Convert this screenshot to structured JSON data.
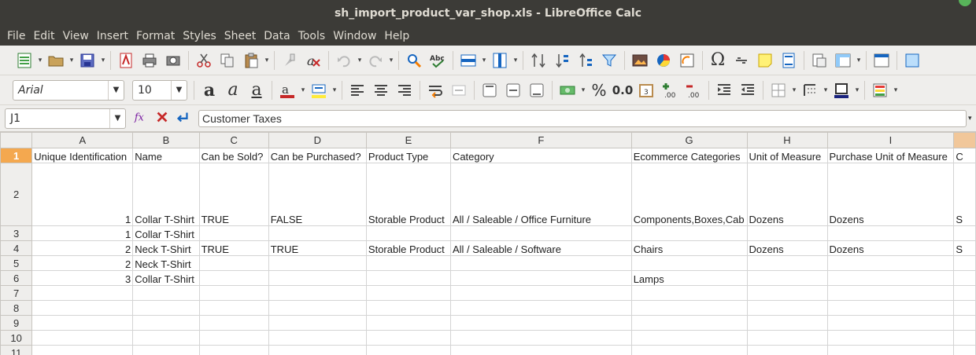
{
  "window": {
    "title": "sh_import_product_var_shop.xls - LibreOffice Calc"
  },
  "menu": [
    "File",
    "Edit",
    "View",
    "Insert",
    "Format",
    "Styles",
    "Sheet",
    "Data",
    "Tools",
    "Window",
    "Help"
  ],
  "toolbar": {
    "font_name": "Arial",
    "font_size": "10",
    "percent": "%",
    "decimal": "0.0"
  },
  "formula_bar": {
    "name_box": "J1",
    "content": "Customer Taxes"
  },
  "sheet": {
    "columns": [
      "A",
      "B",
      "C",
      "D",
      "E",
      "F",
      "G",
      "H",
      "I",
      ""
    ],
    "rows": [
      {
        "num": "1",
        "cells": [
          "Unique Identification",
          "Name",
          "Can be Sold?",
          "Can be Purchased?",
          "Product Type",
          "Category",
          "Ecommerce Categories",
          "Unit of Measure",
          "Purchase Unit of Measure",
          "C"
        ]
      },
      {
        "num": "2",
        "cells": [
          "1",
          "Collar T-Shirt",
          "TRUE",
          "FALSE",
          "Storable Product",
          "All / Saleable / Office Furniture",
          "Components,Boxes,Cab",
          "Dozens",
          "Dozens",
          "S"
        ]
      },
      {
        "num": "3",
        "cells": [
          "1",
          "Collar T-Shirt",
          "",
          "",
          "",
          "",
          "",
          "",
          "",
          ""
        ]
      },
      {
        "num": "4",
        "cells": [
          "2",
          "Neck T-Shirt",
          "TRUE",
          "TRUE",
          "Storable Product",
          "All / Saleable / Software",
          "Chairs",
          "Dozens",
          "Dozens",
          "S"
        ]
      },
      {
        "num": "5",
        "cells": [
          "2",
          "Neck T-Shirt",
          "",
          "",
          "",
          "",
          "",
          "",
          "",
          ""
        ]
      },
      {
        "num": "6",
        "cells": [
          "3",
          "Collar T-Shirt",
          "",
          "",
          "",
          "",
          "Lamps",
          "",
          "",
          ""
        ]
      },
      {
        "num": "7",
        "cells": [
          "",
          "",
          "",
          "",
          "",
          "",
          "",
          "",
          "",
          ""
        ]
      },
      {
        "num": "8",
        "cells": [
          "",
          "",
          "",
          "",
          "",
          "",
          "",
          "",
          "",
          ""
        ]
      },
      {
        "num": "9",
        "cells": [
          "",
          "",
          "",
          "",
          "",
          "",
          "",
          "",
          "",
          ""
        ]
      },
      {
        "num": "10",
        "cells": [
          "",
          "",
          "",
          "",
          "",
          "",
          "",
          "",
          "",
          ""
        ]
      },
      {
        "num": "11",
        "cells": [
          "",
          "",
          "",
          "",
          "",
          "",
          "",
          "",
          "",
          ""
        ]
      }
    ]
  }
}
